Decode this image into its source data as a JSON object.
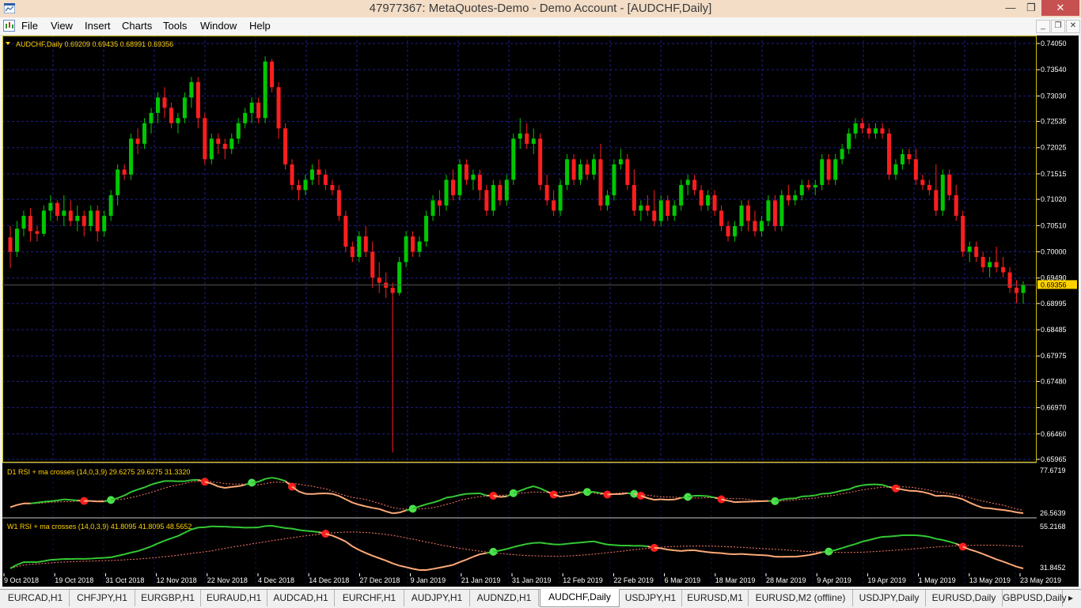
{
  "window": {
    "title": "47977367: MetaQuotes-Demo - Demo Account - [AUDCHF,Daily]",
    "minimize": "—",
    "maximize": "❐",
    "close": "✕"
  },
  "menu": [
    "File",
    "View",
    "Insert",
    "Charts",
    "Tools",
    "Window",
    "Help"
  ],
  "child_controls": [
    "_",
    "❐",
    "✕"
  ],
  "main_chart": {
    "header": "AUDCHF,Daily  0.69209 0.69435 0.68991 0.69356",
    "current_price_label": "0.69356",
    "price_ticks": [
      "0.74050",
      "0.73540",
      "0.73030",
      "0.72535",
      "0.72025",
      "0.71515",
      "0.71020",
      "0.70510",
      "0.70000",
      "0.69490",
      "0.68995",
      "0.68485",
      "0.67975",
      "0.67480",
      "0.66970",
      "0.66460",
      "0.65965"
    ],
    "colors": {
      "bull": "#00c800",
      "bear": "#ff1e1e",
      "grid": "#1f1f8c",
      "axis_text": "#ffffff"
    }
  },
  "indicator1": {
    "header": "D1 RSI + ma crosses (14,0,3,9) 29.6275 29.6275 31.3320",
    "ticks": [
      "77.6719",
      "26.5639"
    ]
  },
  "indicator2": {
    "header": "W1 RSI + ma crosses (14,0,3,9) 41.8095 41.8095 48.5652",
    "ticks": [
      "55.2168",
      "31.8452"
    ]
  },
  "date_axis": [
    "9 Oct 2018",
    "19 Oct 2018",
    "31 Oct 2018",
    "12 Nov 2018",
    "22 Nov 2018",
    "4 Dec 2018",
    "14 Dec 2018",
    "27 Dec 2018",
    "9 Jan 2019",
    "21 Jan 2019",
    "31 Jan 2019",
    "12 Feb 2019",
    "22 Feb 2019",
    "6 Mar 2019",
    "18 Mar 2019",
    "28 Mar 2019",
    "9 Apr 2019",
    "19 Apr 2019",
    "1 May 2019",
    "13 May 2019",
    "23 May 2019"
  ],
  "tabs": [
    "EURCAD,H1",
    "CHFJPY,H1",
    "EURGBP,H1",
    "EURAUD,H1",
    "AUDCAD,H1",
    "EURCHF,H1",
    "AUDJPY,H1",
    "AUDNZD,H1",
    "AUDCHF,Daily",
    "USDJPY,H1",
    "EURUSD,M1",
    "EURUSD,M2 (offline)",
    "USDJPY,Daily",
    "EURUSD,Daily",
    "GBPUSD,Daily"
  ],
  "active_tab": "AUDCHF,Daily",
  "chart_data": {
    "type": "candlestick",
    "title": "AUDCHF,Daily",
    "ylim": [
      0.65965,
      0.7434
    ],
    "ohlc": [
      [
        0.7028,
        0.705,
        0.6968,
        0.7
      ],
      [
        0.7,
        0.706,
        0.699,
        0.7045
      ],
      [
        0.7045,
        0.708,
        0.703,
        0.707
      ],
      [
        0.707,
        0.7085,
        0.702,
        0.704
      ],
      [
        0.704,
        0.705,
        0.702,
        0.7035
      ],
      [
        0.7035,
        0.709,
        0.703,
        0.708
      ],
      [
        0.708,
        0.711,
        0.706,
        0.7095
      ],
      [
        0.7095,
        0.71,
        0.706,
        0.707
      ],
      [
        0.707,
        0.711,
        0.705,
        0.708
      ],
      [
        0.708,
        0.71,
        0.705,
        0.706
      ],
      [
        0.706,
        0.709,
        0.704,
        0.707
      ],
      [
        0.707,
        0.708,
        0.703,
        0.705
      ],
      [
        0.705,
        0.709,
        0.704,
        0.708
      ],
      [
        0.708,
        0.709,
        0.702,
        0.704
      ],
      [
        0.704,
        0.708,
        0.703,
        0.707
      ],
      [
        0.707,
        0.712,
        0.706,
        0.711
      ],
      [
        0.711,
        0.717,
        0.709,
        0.716
      ],
      [
        0.716,
        0.717,
        0.714,
        0.715
      ],
      [
        0.715,
        0.723,
        0.714,
        0.722
      ],
      [
        0.722,
        0.724,
        0.719,
        0.721
      ],
      [
        0.721,
        0.726,
        0.72,
        0.725
      ],
      [
        0.725,
        0.728,
        0.723,
        0.727
      ],
      [
        0.727,
        0.731,
        0.725,
        0.73
      ],
      [
        0.73,
        0.732,
        0.726,
        0.728
      ],
      [
        0.728,
        0.729,
        0.724,
        0.725
      ],
      [
        0.725,
        0.727,
        0.723,
        0.726
      ],
      [
        0.726,
        0.731,
        0.725,
        0.73
      ],
      [
        0.73,
        0.734,
        0.728,
        0.733
      ],
      [
        0.733,
        0.734,
        0.724,
        0.726
      ],
      [
        0.726,
        0.727,
        0.717,
        0.718
      ],
      [
        0.718,
        0.723,
        0.717,
        0.722
      ],
      [
        0.722,
        0.723,
        0.719,
        0.721
      ],
      [
        0.721,
        0.722,
        0.718,
        0.72
      ],
      [
        0.72,
        0.723,
        0.719,
        0.722
      ],
      [
        0.722,
        0.726,
        0.721,
        0.725
      ],
      [
        0.725,
        0.728,
        0.724,
        0.727
      ],
      [
        0.727,
        0.73,
        0.725,
        0.729
      ],
      [
        0.729,
        0.73,
        0.725,
        0.726
      ],
      [
        0.726,
        0.738,
        0.725,
        0.737
      ],
      [
        0.737,
        0.7375,
        0.731,
        0.732
      ],
      [
        0.732,
        0.733,
        0.722,
        0.724
      ],
      [
        0.724,
        0.725,
        0.716,
        0.717
      ],
      [
        0.717,
        0.718,
        0.712,
        0.713
      ],
      [
        0.713,
        0.714,
        0.71,
        0.712
      ],
      [
        0.712,
        0.715,
        0.711,
        0.714
      ],
      [
        0.714,
        0.717,
        0.713,
        0.716
      ],
      [
        0.716,
        0.718,
        0.713,
        0.715
      ],
      [
        0.715,
        0.716,
        0.712,
        0.713
      ],
      [
        0.713,
        0.714,
        0.711,
        0.712
      ],
      [
        0.712,
        0.713,
        0.706,
        0.707
      ],
      [
        0.707,
        0.708,
        0.7,
        0.701
      ],
      [
        0.701,
        0.702,
        0.698,
        0.699
      ],
      [
        0.699,
        0.704,
        0.698,
        0.703
      ],
      [
        0.703,
        0.705,
        0.699,
        0.7
      ],
      [
        0.7,
        0.702,
        0.693,
        0.695
      ],
      [
        0.695,
        0.698,
        0.692,
        0.694
      ],
      [
        0.694,
        0.696,
        0.691,
        0.693
      ],
      [
        0.693,
        0.694,
        0.661,
        0.692
      ],
      [
        0.692,
        0.699,
        0.6915,
        0.698
      ],
      [
        0.698,
        0.704,
        0.697,
        0.703
      ],
      [
        0.703,
        0.704,
        0.699,
        0.7
      ],
      [
        0.7,
        0.703,
        0.699,
        0.702
      ],
      [
        0.702,
        0.708,
        0.701,
        0.707
      ],
      [
        0.707,
        0.711,
        0.706,
        0.71
      ],
      [
        0.71,
        0.712,
        0.707,
        0.709
      ],
      [
        0.709,
        0.715,
        0.708,
        0.714
      ],
      [
        0.714,
        0.716,
        0.71,
        0.711
      ],
      [
        0.711,
        0.718,
        0.71,
        0.717
      ],
      [
        0.717,
        0.718,
        0.713,
        0.714
      ],
      [
        0.714,
        0.716,
        0.712,
        0.715
      ],
      [
        0.715,
        0.716,
        0.71,
        0.712
      ],
      [
        0.712,
        0.713,
        0.707,
        0.708
      ],
      [
        0.708,
        0.714,
        0.707,
        0.713
      ],
      [
        0.713,
        0.714,
        0.709,
        0.71
      ],
      [
        0.71,
        0.715,
        0.709,
        0.714
      ],
      [
        0.714,
        0.723,
        0.713,
        0.722
      ],
      [
        0.722,
        0.726,
        0.72,
        0.723
      ],
      [
        0.723,
        0.725,
        0.72,
        0.721
      ],
      [
        0.721,
        0.724,
        0.719,
        0.722
      ],
      [
        0.722,
        0.723,
        0.712,
        0.713
      ],
      [
        0.713,
        0.715,
        0.709,
        0.71
      ],
      [
        0.71,
        0.712,
        0.707,
        0.708
      ],
      [
        0.708,
        0.714,
        0.707,
        0.713
      ],
      [
        0.713,
        0.719,
        0.712,
        0.718
      ],
      [
        0.718,
        0.719,
        0.713,
        0.714
      ],
      [
        0.714,
        0.718,
        0.713,
        0.717
      ],
      [
        0.717,
        0.718,
        0.714,
        0.715
      ],
      [
        0.715,
        0.719,
        0.714,
        0.718
      ],
      [
        0.718,
        0.721,
        0.708,
        0.709
      ],
      [
        0.709,
        0.712,
        0.708,
        0.711
      ],
      [
        0.711,
        0.718,
        0.71,
        0.717
      ],
      [
        0.717,
        0.72,
        0.716,
        0.718
      ],
      [
        0.718,
        0.719,
        0.712,
        0.713
      ],
      [
        0.713,
        0.716,
        0.707,
        0.708
      ],
      [
        0.708,
        0.71,
        0.706,
        0.709
      ],
      [
        0.709,
        0.711,
        0.707,
        0.708
      ],
      [
        0.708,
        0.712,
        0.705,
        0.706
      ],
      [
        0.706,
        0.711,
        0.705,
        0.71
      ],
      [
        0.71,
        0.711,
        0.706,
        0.707
      ],
      [
        0.707,
        0.71,
        0.706,
        0.709
      ],
      [
        0.709,
        0.714,
        0.708,
        0.713
      ],
      [
        0.713,
        0.715,
        0.711,
        0.714
      ],
      [
        0.714,
        0.715,
        0.711,
        0.712
      ],
      [
        0.712,
        0.713,
        0.708,
        0.709
      ],
      [
        0.709,
        0.712,
        0.708,
        0.711
      ],
      [
        0.711,
        0.712,
        0.707,
        0.708
      ],
      [
        0.708,
        0.709,
        0.704,
        0.705
      ],
      [
        0.705,
        0.706,
        0.702,
        0.703
      ],
      [
        0.703,
        0.706,
        0.702,
        0.705
      ],
      [
        0.705,
        0.71,
        0.704,
        0.709
      ],
      [
        0.709,
        0.71,
        0.704,
        0.706
      ],
      [
        0.706,
        0.708,
        0.703,
        0.704
      ],
      [
        0.704,
        0.707,
        0.703,
        0.706
      ],
      [
        0.706,
        0.711,
        0.705,
        0.71
      ],
      [
        0.71,
        0.711,
        0.704,
        0.705
      ],
      [
        0.705,
        0.712,
        0.704,
        0.711
      ],
      [
        0.711,
        0.713,
        0.709,
        0.71
      ],
      [
        0.71,
        0.712,
        0.709,
        0.711
      ],
      [
        0.711,
        0.714,
        0.71,
        0.713
      ],
      [
        0.713,
        0.714,
        0.712,
        0.7125
      ],
      [
        0.7125,
        0.714,
        0.711,
        0.713
      ],
      [
        0.713,
        0.719,
        0.712,
        0.718
      ],
      [
        0.718,
        0.719,
        0.713,
        0.714
      ],
      [
        0.714,
        0.719,
        0.713,
        0.718
      ],
      [
        0.718,
        0.721,
        0.717,
        0.72
      ],
      [
        0.72,
        0.724,
        0.719,
        0.723
      ],
      [
        0.723,
        0.726,
        0.722,
        0.725
      ],
      [
        0.725,
        0.726,
        0.723,
        0.724
      ],
      [
        0.724,
        0.725,
        0.722,
        0.723
      ],
      [
        0.723,
        0.725,
        0.722,
        0.724
      ],
      [
        0.724,
        0.725,
        0.722,
        0.723
      ],
      [
        0.723,
        0.724,
        0.714,
        0.715
      ],
      [
        0.715,
        0.718,
        0.714,
        0.717
      ],
      [
        0.717,
        0.72,
        0.716,
        0.719
      ],
      [
        0.719,
        0.72,
        0.717,
        0.718
      ],
      [
        0.718,
        0.72,
        0.713,
        0.714
      ],
      [
        0.714,
        0.715,
        0.712,
        0.713
      ],
      [
        0.713,
        0.714,
        0.711,
        0.712
      ],
      [
        0.712,
        0.717,
        0.707,
        0.708
      ],
      [
        0.708,
        0.716,
        0.707,
        0.715
      ],
      [
        0.715,
        0.716,
        0.71,
        0.711
      ],
      [
        0.711,
        0.713,
        0.706,
        0.707
      ],
      [
        0.707,
        0.708,
        0.699,
        0.7
      ],
      [
        0.7,
        0.702,
        0.698,
        0.701
      ],
      [
        0.701,
        0.702,
        0.698,
        0.699
      ],
      [
        0.699,
        0.7,
        0.696,
        0.697
      ],
      [
        0.697,
        0.699,
        0.695,
        0.698
      ],
      [
        0.698,
        0.701,
        0.696,
        0.697
      ],
      [
        0.697,
        0.699,
        0.695,
        0.696
      ],
      [
        0.696,
        0.697,
        0.692,
        0.693
      ],
      [
        0.693,
        0.6945,
        0.69,
        0.692
      ],
      [
        0.692,
        0.6943,
        0.6899,
        0.69356
      ]
    ]
  }
}
